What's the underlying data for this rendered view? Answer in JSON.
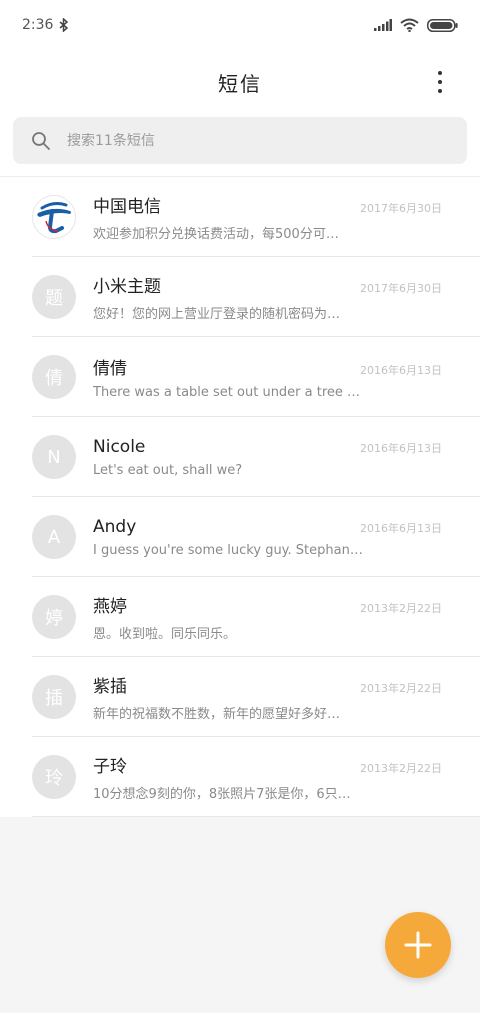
{
  "status_bar": {
    "time": "2:36",
    "icons": [
      "bluetooth-icon",
      "signal-icon",
      "wifi-icon",
      "battery-icon"
    ]
  },
  "header": {
    "title": "短信",
    "menu_icon": "more-vertical-icon"
  },
  "search": {
    "placeholder": "搜索11条短信",
    "icon": "search-icon"
  },
  "messages": [
    {
      "name": "中国电信",
      "date": "2017年6月30日",
      "preview": "欢迎参加积分兑换话费活动，每500分可…",
      "avatar": "",
      "avatar_type": "logo"
    },
    {
      "name": "小米主题",
      "date": "2017年6月30日",
      "preview": "您好！您的网上营业厅登录的随机密码为…",
      "avatar": "题"
    },
    {
      "name": "倩倩",
      "date": "2016年6月13日",
      "preview": "There was a table set out under a tree …",
      "avatar": "倩"
    },
    {
      "name": "Nicole",
      "date": "2016年6月13日",
      "preview": "Let's eat out, shall we?",
      "avatar": "N"
    },
    {
      "name": "Andy",
      "date": "2016年6月13日",
      "preview": "I guess you're some lucky guy. Stephan…",
      "avatar": "A"
    },
    {
      "name": "燕婷",
      "date": "2013年2月22日",
      "preview": "恩。收到啦。同乐同乐。",
      "avatar": "婷"
    },
    {
      "name": "紫插",
      "date": "2013年2月22日",
      "preview": "新年的祝福数不胜数，新年的愿望好多好…",
      "avatar": "插"
    },
    {
      "name": "子玲",
      "date": "2013年2月22日",
      "preview": "10分想念9刻的你，8张照片7张是你，6只…",
      "avatar": "玲"
    }
  ],
  "fab": {
    "icon": "plus-icon"
  },
  "colors": {
    "fab": "#f6a93b",
    "avatar_bg": "#e3e3e3",
    "telecom_blue": "#1a5ea8"
  }
}
